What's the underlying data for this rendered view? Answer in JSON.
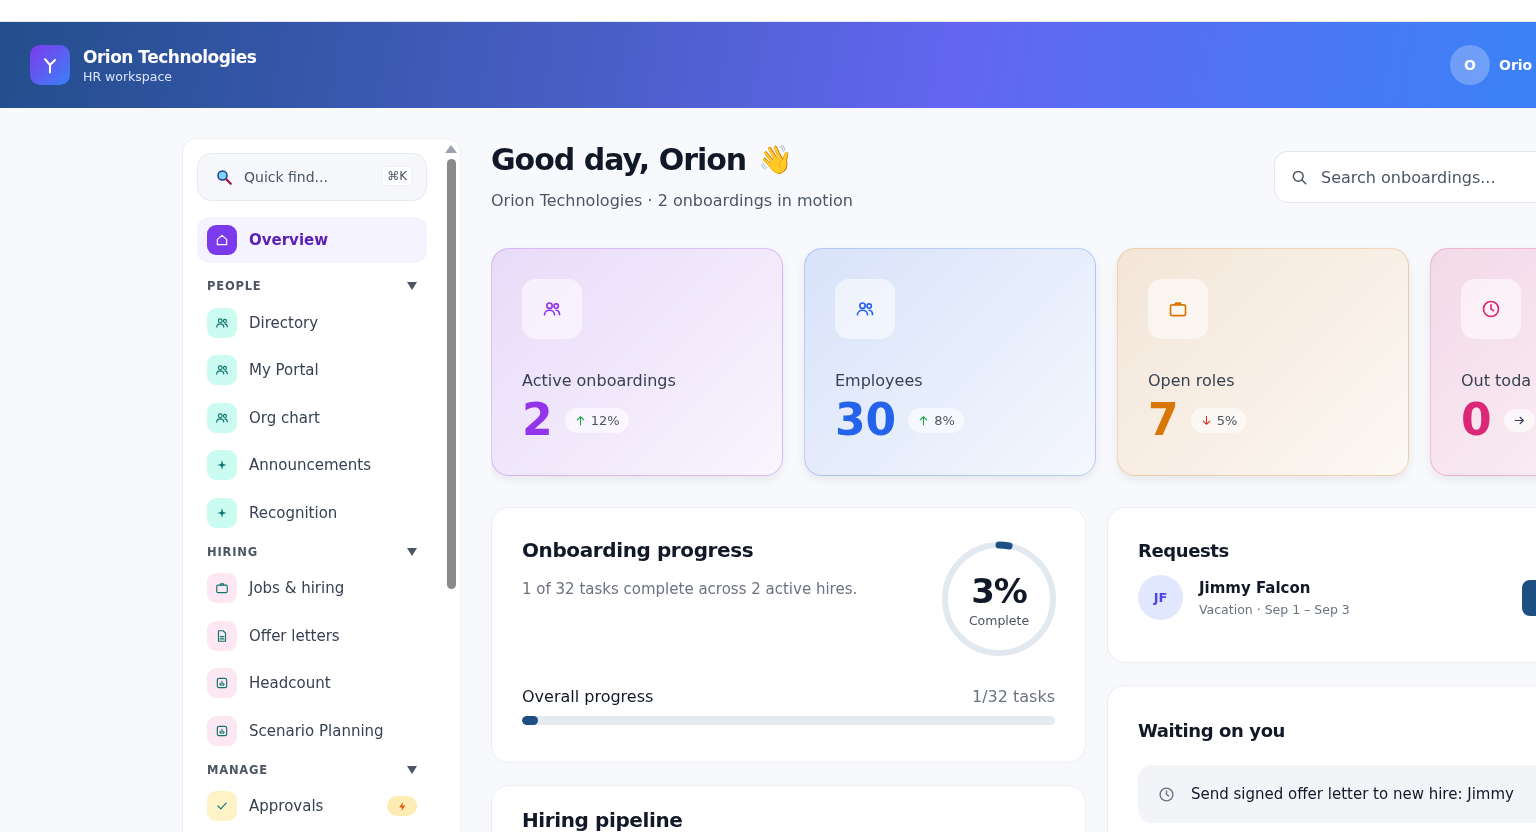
{
  "header": {
    "company": "Orion Technologies",
    "subtitle": "HR workspace",
    "user": {
      "initial": "O",
      "name": "Orio"
    }
  },
  "sidebar": {
    "search": {
      "placeholder": "Quick find...",
      "shortcut": "⌘K"
    },
    "top_item": {
      "label": "Overview",
      "kind": "home",
      "selected": true
    },
    "sections": [
      {
        "title": "PEOPLE",
        "expanded": true,
        "color": "#ccfbf1",
        "items": [
          {
            "label": "Directory",
            "kind": "people",
            "selected": false
          },
          {
            "label": "My Portal",
            "kind": "people",
            "selected": false
          },
          {
            "label": "Org chart",
            "kind": "people",
            "selected": false
          },
          {
            "label": "Announcements",
            "kind": "sparkle",
            "selected": false
          },
          {
            "label": "Recognition",
            "kind": "sparkle",
            "selected": false
          }
        ]
      },
      {
        "title": "HIRING",
        "expanded": true,
        "color": "#fce7f3",
        "items": [
          {
            "label": "Jobs & hiring",
            "kind": "briefcase",
            "selected": false
          },
          {
            "label": "Offer letters",
            "kind": "document",
            "selected": false
          },
          {
            "label": "Headcount",
            "kind": "chart",
            "selected": false
          },
          {
            "label": "Scenario Planning",
            "kind": "chart",
            "selected": false
          }
        ]
      },
      {
        "title": "MANAGE",
        "expanded": true,
        "color": "#fef3c7",
        "items": [
          {
            "label": "Approvals",
            "kind": "check",
            "selected": false,
            "alert": true
          }
        ]
      }
    ]
  },
  "greeting": {
    "title": "Good day, Orion",
    "emoji": "👋",
    "subtitle": "Orion Technologies · 2 onboardings in motion"
  },
  "search": {
    "placeholder": "Search onboardings..."
  },
  "stats": [
    {
      "label": "Active onboardings",
      "value": "2",
      "kind": "people",
      "color": "#9333ea",
      "trend": {
        "kind": "up",
        "text": "12%"
      }
    },
    {
      "label": "Employees",
      "value": "30",
      "kind": "people",
      "color": "#2563eb",
      "trend": {
        "kind": "up",
        "text": "8%"
      }
    },
    {
      "label": "Open roles",
      "value": "7",
      "kind": "briefcase",
      "color": "#d97706",
      "trend": {
        "kind": "down",
        "text": "5%"
      }
    },
    {
      "label": "Out toda",
      "value": "0",
      "kind": "clock",
      "color": "#db2777",
      "trend": {
        "kind": "flat"
      }
    }
  ],
  "progress": {
    "title": "Onboarding progress",
    "description": "1 of 32 tasks complete across 2 active hires.",
    "percent": "3%",
    "percent_label": "Complete",
    "level": 0.03,
    "bar_label": "Overall progress",
    "bar_count": "1/32 tasks"
  },
  "requests": {
    "title": "Requests",
    "items": [
      {
        "initials": "JF",
        "name": "Jimmy Falcon",
        "detail": "Vacation · Sep 1 – Sep 3"
      }
    ]
  },
  "waiting": {
    "title": "Waiting on you",
    "items": [
      {
        "text": "Send signed offer letter to new hire: Jimmy"
      }
    ]
  },
  "pipeline": {
    "title": "Hiring pipeline"
  }
}
